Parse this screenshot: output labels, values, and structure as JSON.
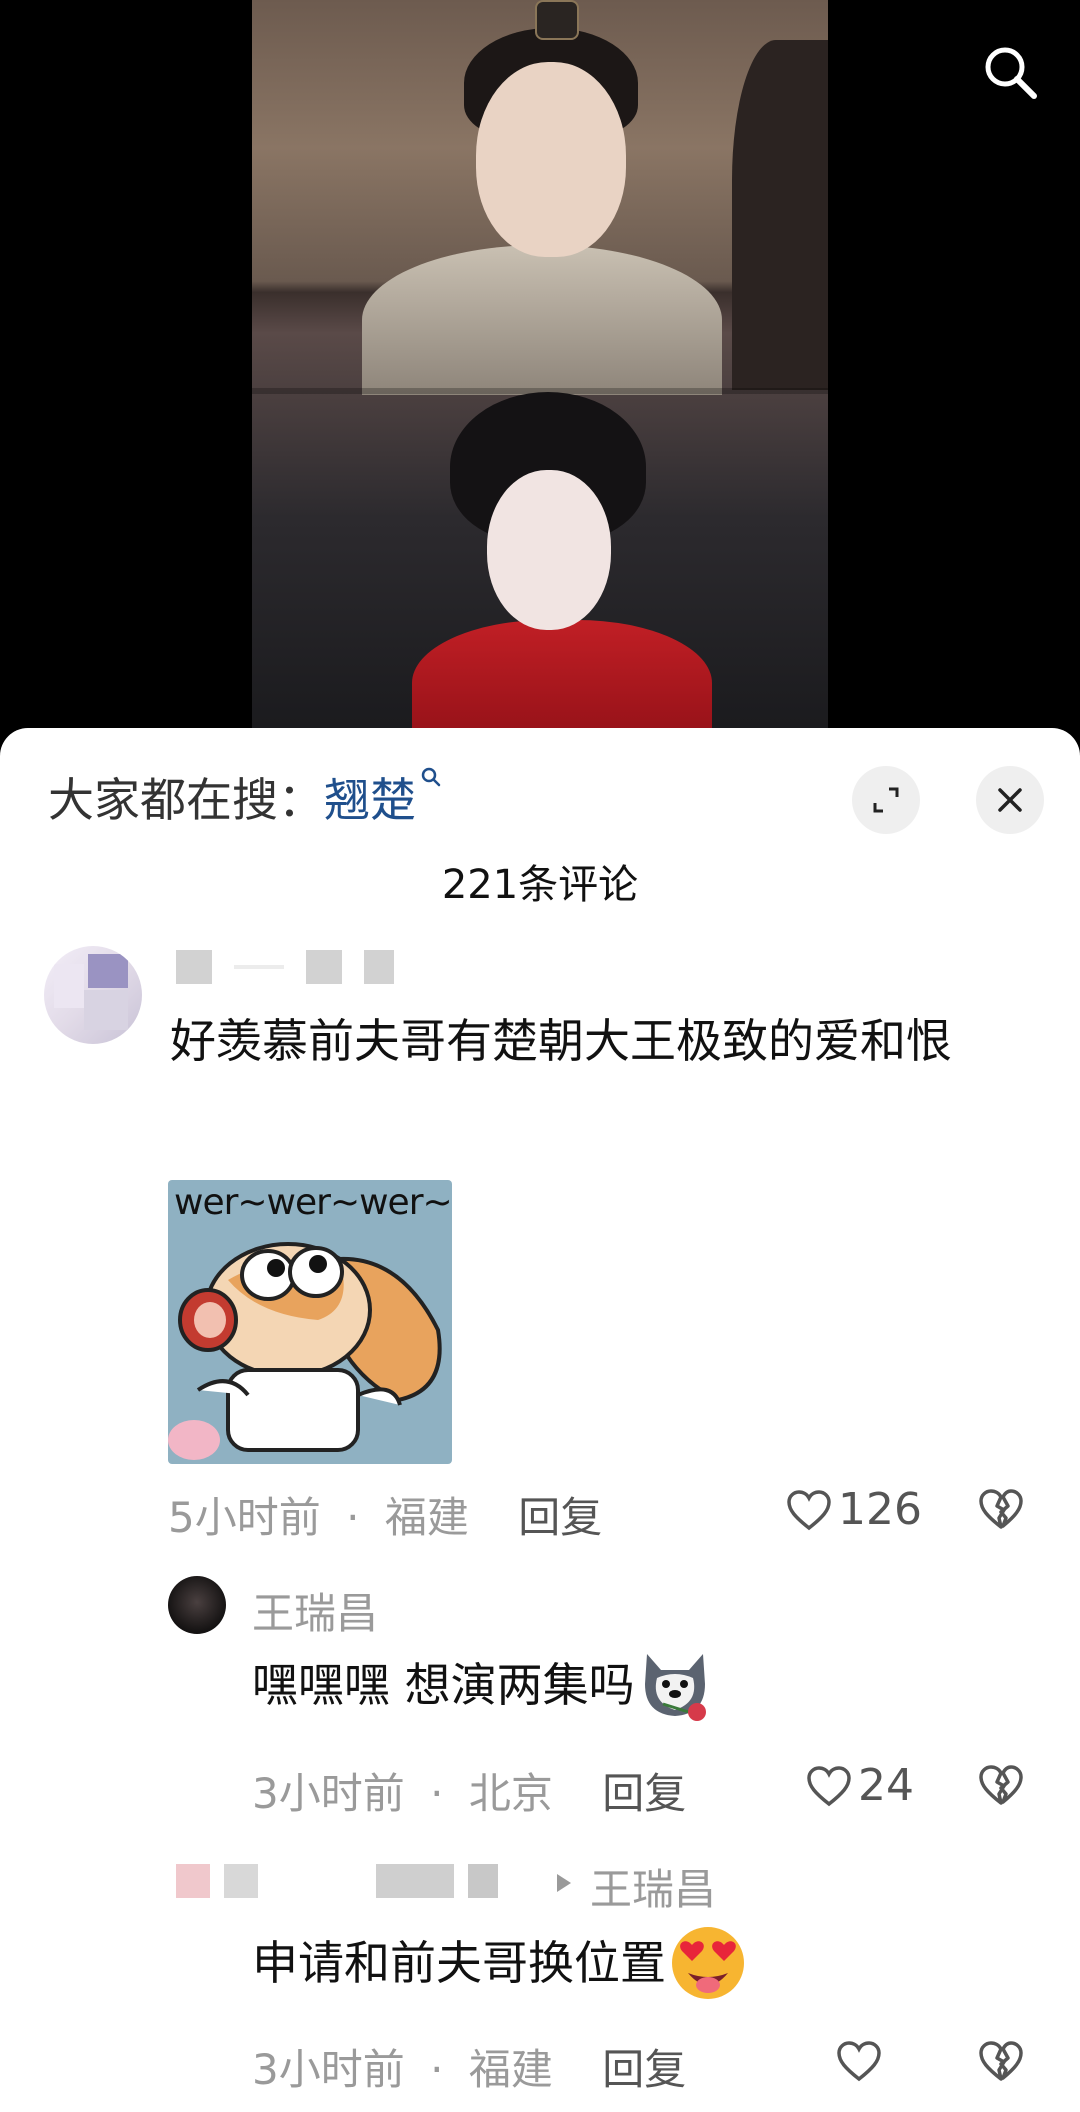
{
  "header": {
    "search_prefix": "大家都在搜：",
    "search_keyword": "翘楚",
    "comment_count": "221条评论"
  },
  "comments": [
    {
      "text": "好羡慕前夫哥有楚朝大王极致的爱和恨",
      "sticker_caption": "wer~wer~wer~",
      "time": "5小时前",
      "location": "福建",
      "reply_label": "回复",
      "likes": "126",
      "replies": [
        {
          "author": "王瑞昌",
          "text": "嘿嘿嘿 想演两集吗",
          "emoji": "husky-rose-emoji",
          "time": "3小时前",
          "location": "北京",
          "reply_label": "回复",
          "likes": "24"
        },
        {
          "reply_to": "王瑞昌",
          "text": "申请和前夫哥换位置",
          "emoji": "heart-eyes-emoji",
          "time": "3小时前",
          "location": "福建",
          "reply_label": "回复"
        }
      ]
    }
  ],
  "separator": "·",
  "colors": {
    "keyword": "#1f4f8c",
    "sheet_bg": "#ffffff",
    "meta_gray": "#9a9a9a"
  }
}
